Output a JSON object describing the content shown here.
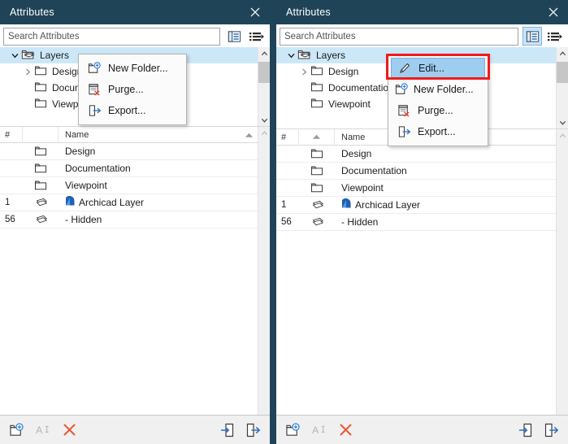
{
  "window": {
    "title": "Attributes",
    "close_icon": "close-icon"
  },
  "search": {
    "placeholder": "Search Attributes",
    "value": "",
    "buttons": [
      {
        "name": "tree-view-toggle-icon",
        "label": "Tree View"
      },
      {
        "name": "list-options-icon",
        "label": "List Options"
      }
    ]
  },
  "tree": {
    "items": [
      {
        "label": "Layers",
        "level": 0,
        "expanded": true,
        "selected": true,
        "icon": "layers-folder-icon"
      },
      {
        "label": "Design",
        "level": 1,
        "expanded": false,
        "selected": false,
        "icon": "folder-icon"
      },
      {
        "label": "Documentation",
        "level": 1,
        "expanded": null,
        "selected": false,
        "icon": "folder-icon"
      },
      {
        "label": "Viewpoint",
        "level": 1,
        "expanded": null,
        "selected": false,
        "icon": "folder-icon"
      }
    ]
  },
  "table": {
    "headers": {
      "num": "#",
      "icon": "",
      "name": "Name"
    },
    "sort_indicator": "ascending",
    "rows": [
      {
        "num": "",
        "icon": "folder-icon",
        "name": "Design",
        "name_icon": ""
      },
      {
        "num": "",
        "icon": "folder-icon",
        "name": "Documentation",
        "name_icon": ""
      },
      {
        "num": "",
        "icon": "folder-icon",
        "name": "Viewpoint",
        "name_icon": ""
      },
      {
        "num": "1",
        "icon": "layer-icon",
        "name": "Archicad Layer",
        "name_icon": "archicad-layer-badge-icon"
      },
      {
        "num": "56",
        "icon": "layer-icon",
        "name": "- Hidden",
        "name_icon": ""
      }
    ]
  },
  "bottom_toolbar": {
    "buttons": [
      {
        "name": "new-folder-button",
        "label": "New Folder",
        "icon": "new-folder-icon",
        "enabled": true
      },
      {
        "name": "rename-button",
        "label": "Rename",
        "icon": "rename-text-icon",
        "enabled": false
      },
      {
        "name": "delete-button",
        "label": "Delete",
        "icon": "delete-x-icon",
        "enabled": true
      },
      {
        "name": "import-button",
        "label": "Import",
        "icon": "import-icon",
        "enabled": true
      },
      {
        "name": "export-button",
        "label": "Export",
        "icon": "export-icon",
        "enabled": true
      }
    ]
  },
  "context_menu_left": {
    "items": [
      {
        "label": "New Folder...",
        "icon": "new-folder-icon",
        "highlighted": false
      },
      {
        "label": "Purge...",
        "icon": "purge-icon",
        "highlighted": false
      },
      {
        "label": "Export...",
        "icon": "export-icon",
        "highlighted": false
      }
    ]
  },
  "context_menu_right": {
    "items": [
      {
        "label": "Edit...",
        "icon": "edit-pencil-icon",
        "highlighted": true
      },
      {
        "label": "New Folder...",
        "icon": "new-folder-icon",
        "highlighted": false
      },
      {
        "label": "Purge...",
        "icon": "purge-icon",
        "highlighted": false
      },
      {
        "label": "Export...",
        "icon": "export-icon",
        "highlighted": false
      }
    ]
  },
  "colors": {
    "titlebar": "#1f4458",
    "selection": "#cce8f8",
    "menu_highlight": "#9ecdf0",
    "annotation_red": "#ee1c1c",
    "accent_blue": "#2f6fb8",
    "delete_red": "#e8583c"
  }
}
